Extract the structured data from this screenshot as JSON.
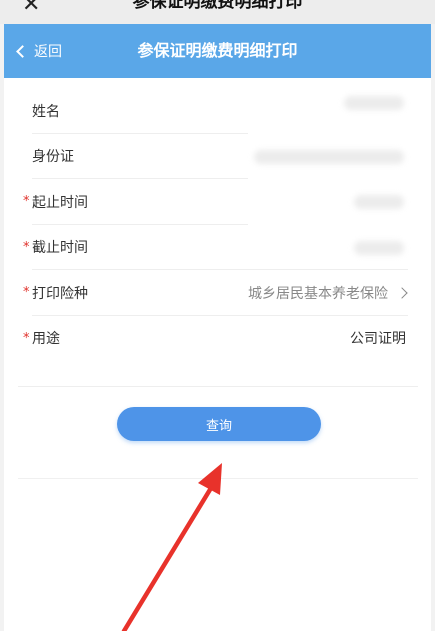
{
  "wechat": {
    "close_icon": "close-icon",
    "title": "参保证明缴费明细打印",
    "more_icon": "more-icon",
    "more_glyph": "···"
  },
  "header": {
    "back_label": "返回",
    "title": "参保证明缴费明细打印",
    "background_color": "#5aa7e8"
  },
  "form": {
    "rows": [
      {
        "label": "姓名",
        "required": false,
        "value": ""
      },
      {
        "label": "身份证",
        "required": false,
        "value": ""
      },
      {
        "label": "起止时间",
        "required": true,
        "value": ""
      },
      {
        "label": "截止时间",
        "required": true,
        "value": ""
      },
      {
        "label": "打印险种",
        "required": true,
        "value": "城乡居民基本养老保险"
      },
      {
        "label": "用途",
        "required": true,
        "value": "公司证明"
      }
    ],
    "required_mark": "*",
    "required_color": "#e0302a"
  },
  "query_button": {
    "label": "查询",
    "color": "#4e94e8"
  },
  "annotation": {
    "arrow_color": "#e8322b"
  }
}
